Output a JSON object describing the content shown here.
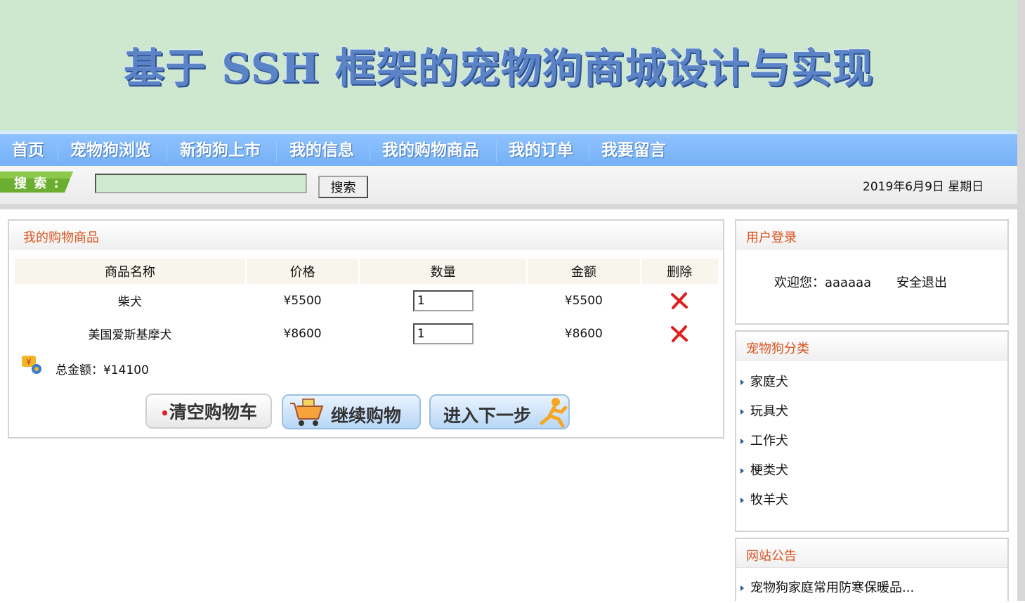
{
  "banner": {
    "title": "基于 SSH 框架的宠物狗商城设计与实现"
  },
  "nav": {
    "items": [
      {
        "label": "首页"
      },
      {
        "label": "宠物狗浏览"
      },
      {
        "label": "新狗狗上市"
      },
      {
        "label": "我的信息"
      },
      {
        "label": "我的购物商品"
      },
      {
        "label": "我的订单"
      },
      {
        "label": "我要留言"
      }
    ]
  },
  "search": {
    "tag_label": "搜 索 :",
    "input_value": "",
    "button_label": "搜索",
    "date_text": "2019年6月9日 星期日"
  },
  "cart": {
    "panel_title": "我的购物商品",
    "columns": [
      "商品名称",
      "价格",
      "数量",
      "金额",
      "删除"
    ],
    "rows": [
      {
        "name": "柴犬",
        "price": "¥5500",
        "quantity": "1",
        "amount": "¥5500"
      },
      {
        "name": "美国爱斯基摩犬",
        "price": "¥8600",
        "quantity": "1",
        "amount": "¥8600"
      }
    ],
    "total_text": "总金额：¥14100",
    "buttons": {
      "clear": "清空购物车",
      "continue": "继续购物",
      "next": "进入下一步"
    }
  },
  "login": {
    "panel_title": "用户登录",
    "welcome_text": "欢迎您：aaaaaa",
    "logout_label": "安全退出"
  },
  "categories": {
    "panel_title": "宠物狗分类",
    "items": [
      "家庭犬",
      "玩具犬",
      "工作犬",
      "梗类犬",
      "牧羊犬"
    ]
  },
  "notice": {
    "panel_title": "网站公告",
    "items": [
      "宠物狗家庭常用防寒保暖品..."
    ]
  },
  "colors": {
    "banner_bg": "#cde8cf",
    "nav_bg": "#7ab5f8",
    "panel_title": "#d9531e",
    "delete_icon": "#e02020"
  }
}
